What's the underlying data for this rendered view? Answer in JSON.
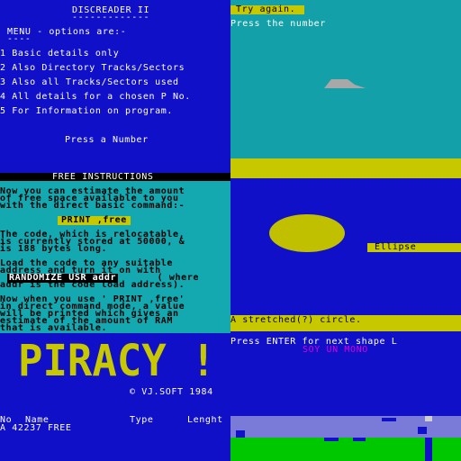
{
  "discreader": {
    "title": "DISCREADER II",
    "title_rule": "-------------",
    "menu_header": "MENU - options are:-",
    "menu_rule": "----",
    "options": [
      "1 Basic details only",
      "2 Also Directory Tracks/Sectors",
      "3 Also all Tracks/Sectors used",
      "4 All details for a chosen P No.",
      "5 For Information on program."
    ],
    "prompt": "Press a Number"
  },
  "try_screen": {
    "banner": "Try again.",
    "prompt": "Press the number"
  },
  "free_instructions": {
    "title": "FREE INSTRUCTIONS",
    "para1": [
      "Now you can estimate the amount",
      "of free space available to you",
      "with the direct basic command:-"
    ],
    "command": "PRINT ,free",
    "para2": [
      "The code, which is relocatable,",
      "is currently stored at 50000, &",
      "is 188 bytes long."
    ],
    "para3a": [
      "Load the code to any suitable",
      "address and turn it on with"
    ],
    "randomize": "RANDOMIZE USR addr",
    "randomize_tail": " ( where",
    "para3b": [
      "addr is the code load address)."
    ],
    "para4": [
      "Now when you use ' PRINT ,free'",
      "in direct command mode, a value",
      "will be printed which gives an",
      "estimate of the amount of RAM",
      "that is available."
    ]
  },
  "ellipse_screen": {
    "ellipse_label": "Ellipse",
    "caption": "A stretched(?) circle.",
    "prompt": "Press ENTER for next shape L",
    "subtitle": "SOY UN MONO"
  },
  "piracy": {
    "logo_text": "PIRACY !",
    "copyright": "© VJ.SOFT 1984",
    "columns": [
      "No",
      "Name",
      "Type",
      "Lenght"
    ],
    "row": "A 42237 FREE"
  },
  "colors": {
    "spectrum_blue": "#1010c8",
    "spectrum_cyan": "#14a8b0",
    "spectrum_yellow": "#c8c800",
    "spectrum_green": "#00c800",
    "spectrum_magenta": "#d800d8"
  }
}
